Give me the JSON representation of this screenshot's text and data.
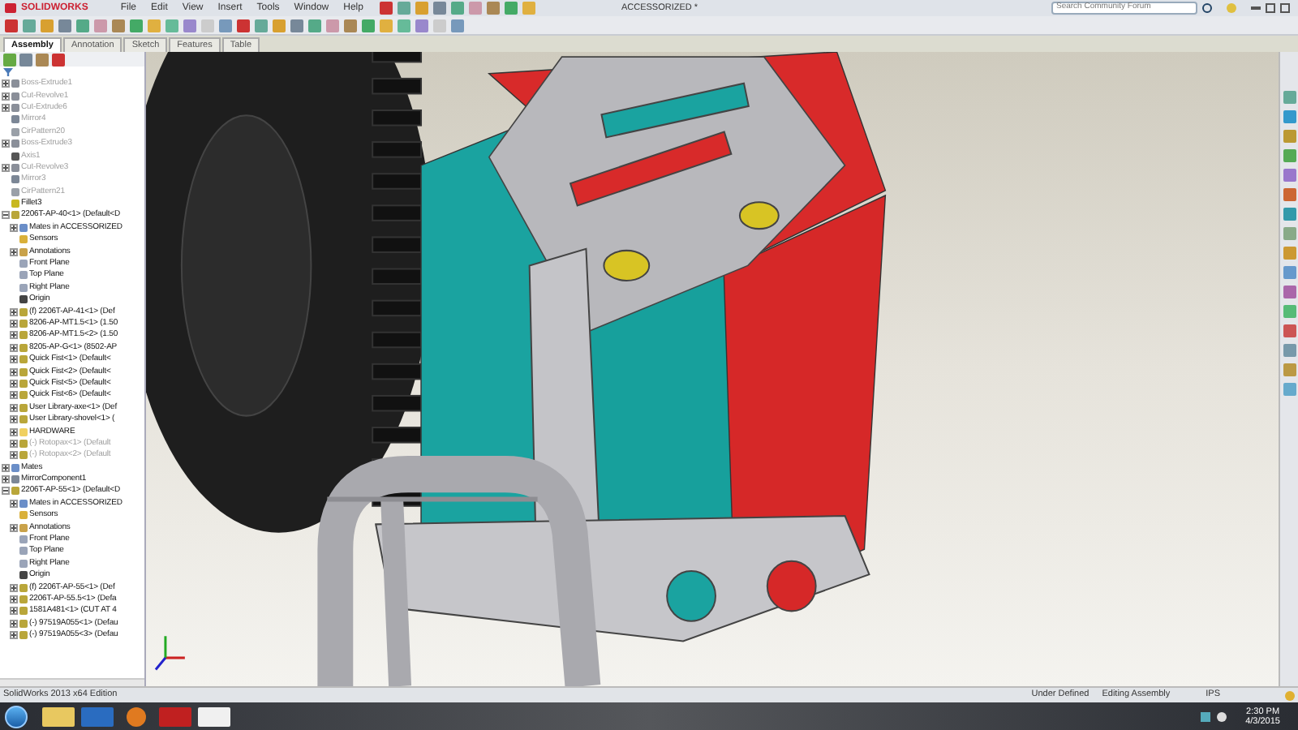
{
  "title_bar": {
    "logo": "SOLIDWORKS",
    "menus": [
      "File",
      "Edit",
      "View",
      "Insert",
      "Tools",
      "Window",
      "Help"
    ],
    "document_title": "ACCESSORIZED *",
    "search": {
      "placeholder": "Search Community Forum"
    }
  },
  "tabs": [
    {
      "label": "Assembly",
      "selected": true
    },
    {
      "label": "Annotation",
      "selected": false
    },
    {
      "label": "Sketch",
      "selected": false
    },
    {
      "label": "Features",
      "selected": false
    },
    {
      "label": "Table",
      "selected": false
    }
  ],
  "tree": {
    "items": [
      {
        "kind": "feature",
        "label": "Boss-Extrude1",
        "suppressed": true,
        "expanded": false
      },
      {
        "kind": "feature",
        "label": "Cut-Revolve1",
        "suppressed": true,
        "expanded": false
      },
      {
        "kind": "feature",
        "label": "Cut-Extrude6",
        "suppressed": true,
        "expanded": false
      },
      {
        "kind": "mirror",
        "label": "Mirror4",
        "suppressed": true
      },
      {
        "kind": "pattern",
        "label": "CirPattern20",
        "suppressed": true
      },
      {
        "kind": "feature",
        "label": "Boss-Extrude3",
        "suppressed": true,
        "expanded": false
      },
      {
        "kind": "axis",
        "label": "Axis1",
        "suppressed": true
      },
      {
        "kind": "feature",
        "label": "Cut-Revolve3",
        "suppressed": true,
        "expanded": false
      },
      {
        "kind": "mirror",
        "label": "Mirror3",
        "suppressed": true
      },
      {
        "kind": "pattern",
        "label": "CirPattern21",
        "suppressed": true
      },
      {
        "kind": "fillet",
        "label": "Fillet3",
        "suppressed": false
      },
      {
        "kind": "component",
        "label": "2206T-AP-40<1> (Default<D",
        "suppressed": false,
        "expanded": true,
        "children": [
          {
            "kind": "mates",
            "label": "Mates in ACCESSORIZED",
            "suppressed": false,
            "expanded": false
          },
          {
            "kind": "sensors",
            "label": "Sensors",
            "suppressed": false
          },
          {
            "kind": "annotations",
            "label": "Annotations",
            "suppressed": false,
            "expanded": false
          },
          {
            "kind": "plane",
            "label": "Front Plane",
            "suppressed": false
          },
          {
            "kind": "plane",
            "label": "Top Plane",
            "suppressed": false
          },
          {
            "kind": "plane",
            "label": "Right Plane",
            "suppressed": false
          },
          {
            "kind": "origin",
            "label": "Origin",
            "suppressed": false
          },
          {
            "kind": "component",
            "label": "(f) 2206T-AP-41<1> (Def",
            "suppressed": false,
            "expanded": false
          },
          {
            "kind": "component",
            "label": "8206-AP-MT1.5<1> (1.50",
            "suppressed": false,
            "expanded": false
          },
          {
            "kind": "component",
            "label": "8206-AP-MT1.5<2> (1.50",
            "suppressed": false,
            "expanded": false
          },
          {
            "kind": "component",
            "label": "8205-AP-G<1> (8502-AP",
            "suppressed": false,
            "expanded": false
          },
          {
            "kind": "component",
            "label": "Quick Fist<1> (Default<",
            "suppressed": false,
            "expanded": false
          },
          {
            "kind": "component",
            "label": "Quick Fist<2> (Default<",
            "suppressed": false,
            "expanded": false
          },
          {
            "kind": "component",
            "label": "Quick Fist<5> (Default<",
            "suppressed": false,
            "expanded": false
          },
          {
            "kind": "component",
            "label": "Quick Fist<6> (Default<",
            "suppressed": false,
            "expanded": false
          },
          {
            "kind": "component",
            "label": "User Library-axe<1> (Def",
            "suppressed": false,
            "expanded": false
          },
          {
            "kind": "component",
            "label": "User Library-shovel<1> (",
            "suppressed": false,
            "expanded": false
          },
          {
            "kind": "folder",
            "label": "HARDWARE",
            "suppressed": false,
            "expanded": false
          },
          {
            "kind": "component",
            "label": "(-) Rotopax<1> (Default",
            "suppressed": true,
            "expanded": false
          },
          {
            "kind": "component",
            "label": "(-) Rotopax<2> (Default",
            "suppressed": true,
            "expanded": false
          }
        ]
      },
      {
        "kind": "mates",
        "label": "Mates",
        "suppressed": false,
        "expanded": false
      },
      {
        "kind": "mirror",
        "label": "MirrorComponent1",
        "suppressed": false,
        "expanded": false
      },
      {
        "kind": "component",
        "label": "2206T-AP-55<1> (Default<D",
        "suppressed": false,
        "expanded": true,
        "children": [
          {
            "kind": "mates",
            "label": "Mates in ACCESSORIZED",
            "suppressed": false,
            "expanded": false
          },
          {
            "kind": "sensors",
            "label": "Sensors",
            "suppressed": false
          },
          {
            "kind": "annotations",
            "label": "Annotations",
            "suppressed": false,
            "expanded": false
          },
          {
            "kind": "plane",
            "label": "Front Plane",
            "suppressed": false
          },
          {
            "kind": "plane",
            "label": "Top Plane",
            "suppressed": false
          },
          {
            "kind": "plane",
            "label": "Right Plane",
            "suppressed": false
          },
          {
            "kind": "origin",
            "label": "Origin",
            "suppressed": false
          },
          {
            "kind": "component",
            "label": "(f) 2206T-AP-55<1> (Def",
            "suppressed": false,
            "expanded": false
          },
          {
            "kind": "component",
            "label": "2206T-AP-55.5<1> (Defa",
            "suppressed": false,
            "expanded": false
          },
          {
            "kind": "component",
            "label": "1581A481<1> (CUT AT 4",
            "suppressed": false,
            "expanded": false
          },
          {
            "kind": "component",
            "label": "(-) 97519A055<1> (Defau",
            "suppressed": false,
            "expanded": false
          },
          {
            "kind": "component",
            "label": "(-) 97519A055<3> (Defau",
            "suppressed": false,
            "expanded": false
          }
        ]
      }
    ]
  },
  "status_bar": {
    "edition": "SolidWorks 2013 x64 Edition",
    "state": "Under Defined",
    "mode": "Editing Assembly",
    "units": "IPS"
  },
  "taskbar": {
    "time": "2:30 PM",
    "date": "4/3/2015"
  }
}
